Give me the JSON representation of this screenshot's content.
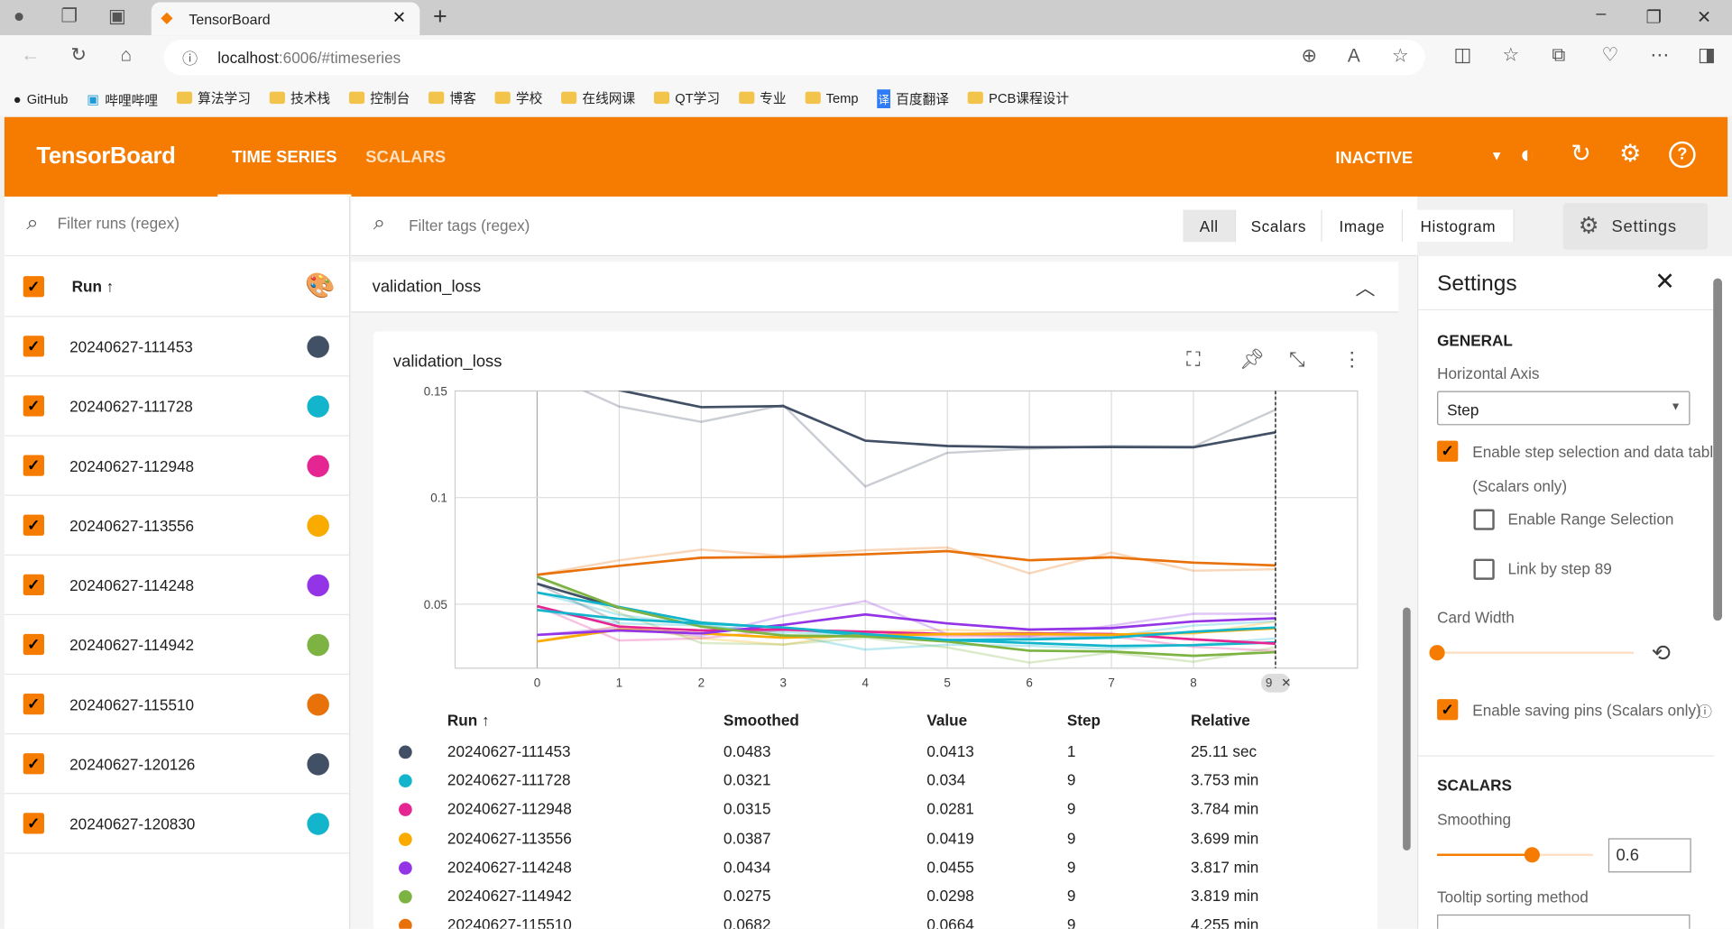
{
  "browser": {
    "tab_title": "TensorBoard",
    "url_host": "localhost",
    "url_rest": ":6006/#timeseries",
    "bookmarks": [
      "GitHub",
      "哔哩哔哩",
      "算法学习",
      "技术栈",
      "控制台",
      "博客",
      "学校",
      "在线网课",
      "QT学习",
      "专业",
      "Temp",
      "百度翻译",
      "PCB课程设计"
    ]
  },
  "header": {
    "logo": "TensorBoard",
    "tabs": [
      "TIME SERIES",
      "SCALARS"
    ],
    "active_tab": "TIME SERIES",
    "status": "INACTIVE"
  },
  "runs": {
    "filter_placeholder": "Filter runs (regex)",
    "column": "Run ↑",
    "items": [
      {
        "name": "20240627-111453",
        "color": "#425066",
        "checked": true
      },
      {
        "name": "20240627-111728",
        "color": "#12b5cb",
        "checked": true
      },
      {
        "name": "20240627-112948",
        "color": "#e52592",
        "checked": true
      },
      {
        "name": "20240627-113556",
        "color": "#f9ab00",
        "checked": true
      },
      {
        "name": "20240627-114248",
        "color": "#9334e6",
        "checked": true
      },
      {
        "name": "20240627-114942",
        "color": "#7cb342",
        "checked": true
      },
      {
        "name": "20240627-115510",
        "color": "#e8710a",
        "checked": true
      },
      {
        "name": "20240627-120126",
        "color": "#425066",
        "checked": true
      },
      {
        "name": "20240627-120830",
        "color": "#12b5cb",
        "checked": true
      }
    ]
  },
  "main": {
    "filter_placeholder": "Filter tags (regex)",
    "type_tabs": [
      "All",
      "Scalars",
      "Image",
      "Histogram"
    ],
    "active_type": "All",
    "settings_button": "Settings",
    "group_title": "validation_loss",
    "card_title": "validation_loss",
    "selected_step_chip": "9",
    "table": {
      "headers": [
        "Run ↑",
        "Smoothed",
        "Value",
        "Step",
        "Relative"
      ],
      "rows": [
        {
          "color": "#425066",
          "run": "20240627-111453",
          "smoothed": "0.0483",
          "value": "0.0413",
          "step": "1",
          "relative": "25.11 sec"
        },
        {
          "color": "#12b5cb",
          "run": "20240627-111728",
          "smoothed": "0.0321",
          "value": "0.034",
          "step": "9",
          "relative": "3.753 min"
        },
        {
          "color": "#e52592",
          "run": "20240627-112948",
          "smoothed": "0.0315",
          "value": "0.0281",
          "step": "9",
          "relative": "3.784 min"
        },
        {
          "color": "#f9ab00",
          "run": "20240627-113556",
          "smoothed": "0.0387",
          "value": "0.0419",
          "step": "9",
          "relative": "3.699 min"
        },
        {
          "color": "#9334e6",
          "run": "20240627-114248",
          "smoothed": "0.0434",
          "value": "0.0455",
          "step": "9",
          "relative": "3.817 min"
        },
        {
          "color": "#7cb342",
          "run": "20240627-114942",
          "smoothed": "0.0275",
          "value": "0.0298",
          "step": "9",
          "relative": "3.819 min"
        },
        {
          "color": "#e8710a",
          "run": "20240627-115510",
          "smoothed": "0.0682",
          "value": "0.0664",
          "step": "9",
          "relative": "4.255 min"
        }
      ]
    }
  },
  "chart_data": {
    "type": "line",
    "title": "validation_loss",
    "xlabel": "",
    "ylabel": "",
    "xlim": [
      -1,
      10
    ],
    "ylim": [
      0.02,
      0.15
    ],
    "x_ticks": [
      "0",
      "1",
      "2",
      "3",
      "4",
      "5",
      "6",
      "7",
      "8",
      "9"
    ],
    "y_ticks": [
      "0.05",
      "0.1",
      "0.15"
    ],
    "grid": true,
    "selected_step": 9,
    "x": [
      0,
      1,
      2,
      3,
      4,
      5,
      6,
      7,
      8,
      9
    ],
    "series": [
      {
        "run": "20240627-111453",
        "color": "#425066",
        "smoothed": [
          0.0596,
          0.0483
        ],
        "raw": [
          0.0596,
          0.0413
        ]
      },
      {
        "run": "20240627-111728",
        "color": "#12b5cb",
        "smoothed": [
          0.0555,
          0.0487,
          0.0414,
          0.0388,
          0.0353,
          0.0332,
          0.0318,
          0.0304,
          0.0308,
          0.0321
        ],
        "raw": [
          0.0555,
          0.045,
          0.04,
          0.036,
          0.0287,
          0.031,
          0.0305,
          0.029,
          0.031,
          0.034
        ]
      },
      {
        "run": "20240627-112948",
        "color": "#e52592",
        "smoothed": [
          0.0491,
          0.0395,
          0.0377,
          0.0381,
          0.0371,
          0.036,
          0.0363,
          0.036,
          0.0335,
          0.0315
        ],
        "raw": [
          0.0491,
          0.033,
          0.034,
          0.038,
          0.036,
          0.035,
          0.035,
          0.035,
          0.03,
          0.0281
        ]
      },
      {
        "run": "20240627-113556",
        "color": "#f9ab00",
        "smoothed": [
          0.0325,
          0.0381,
          0.0363,
          0.0343,
          0.0353,
          0.036,
          0.036,
          0.0357,
          0.0367,
          0.0387
        ],
        "raw": [
          0.0325,
          0.04,
          0.034,
          0.031,
          0.037,
          0.038,
          0.037,
          0.035,
          0.036,
          0.0419
        ]
      },
      {
        "run": "20240627-114248",
        "color": "#9334e6",
        "smoothed": [
          0.0356,
          0.0377,
          0.0363,
          0.0403,
          0.0452,
          0.041,
          0.0381,
          0.0388,
          0.0419,
          0.0434
        ],
        "raw": [
          0.0356,
          0.039,
          0.035,
          0.0445,
          0.0515,
          0.036,
          0.035,
          0.04,
          0.0455,
          0.0455
        ]
      },
      {
        "run": "20240627-114942",
        "color": "#7cb342",
        "smoothed": [
          0.0629,
          0.0484,
          0.0395,
          0.0353,
          0.0349,
          0.0325,
          0.0282,
          0.0278,
          0.0258,
          0.0275
        ],
        "raw": [
          0.0629,
          0.046,
          0.0318,
          0.0311,
          0.0343,
          0.0297,
          0.0226,
          0.0273,
          0.023,
          0.0298
        ]
      },
      {
        "run": "20240627-115510",
        "color": "#e8710a",
        "smoothed": [
          0.0638,
          0.068,
          0.0718,
          0.0722,
          0.0734,
          0.0749,
          0.0706,
          0.072,
          0.0695,
          0.0682
        ],
        "raw": [
          0.0638,
          0.0706,
          0.0756,
          0.0727,
          0.0753,
          0.0766,
          0.0645,
          0.0742,
          0.0657,
          0.0664
        ]
      },
      {
        "run": "20240627-120126",
        "color": "#425066",
        "smoothed": [
          0.16,
          0.1504,
          0.1424,
          0.1429,
          0.1267,
          0.1242,
          0.1236,
          0.1237,
          0.1236,
          0.1306
        ],
        "raw": [
          0.16,
          0.1427,
          0.1355,
          0.1434,
          0.1052,
          0.121,
          0.1229,
          0.1242,
          0.1239,
          0.1412
        ]
      },
      {
        "run": "20240627-120830",
        "color": "#12b5cb",
        "smoothed": [
          0.0473,
          0.0431,
          0.041,
          0.0391,
          0.036,
          0.0332,
          0.0335,
          0.0343,
          0.0371,
          0.0391
        ],
        "raw": [
          0.0473,
          0.041,
          0.04,
          0.037,
          0.035,
          0.033,
          0.034,
          0.035,
          0.04,
          0.042
        ]
      }
    ]
  },
  "settings": {
    "title": "Settings",
    "general": "GENERAL",
    "horizontal_axis_label": "Horizontal Axis",
    "horizontal_axis_value": "Step",
    "step_selection": "Enable step selection and data table",
    "step_selection_sub": "(Scalars only)",
    "step_selection_checked": true,
    "range_selection": "Enable Range Selection",
    "range_selection_checked": false,
    "link_by_step": "Link by step 89",
    "link_by_step_checked": false,
    "card_width": "Card Width",
    "card_width_level": 0,
    "saving_pins": "Enable saving pins (Scalars only)",
    "saving_pins_checked": true,
    "scalars": "SCALARS",
    "smoothing": "Smoothing",
    "smoothing_value": "0.6",
    "tooltip_sort": "Tooltip sorting method"
  }
}
